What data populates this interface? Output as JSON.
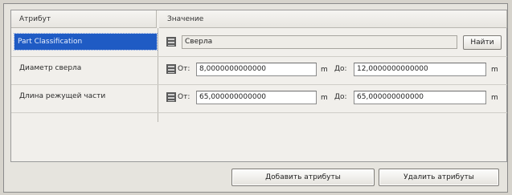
{
  "table": {
    "header_attribute": "Атрибут",
    "header_value": "Значение"
  },
  "rows": [
    {
      "label": "Part Classification",
      "value": "Сверла",
      "find_button": "Найти"
    },
    {
      "label": "Диаметр сверла",
      "from_label": "От:",
      "from_value": "8,0000000000000",
      "from_unit": "m",
      "to_label": "До:",
      "to_value": "12,0000000000000",
      "to_unit": "m"
    },
    {
      "label": "Длина режущей части",
      "from_label": "От:",
      "from_value": "65,000000000000",
      "from_unit": "m",
      "to_label": "До:",
      "to_value": "65,000000000000",
      "to_unit": "m"
    }
  ],
  "buttons": {
    "add": "Добавить атрибуты",
    "remove": "Удалить атрибуты"
  },
  "icons": {
    "row_icon": "database-icon"
  }
}
